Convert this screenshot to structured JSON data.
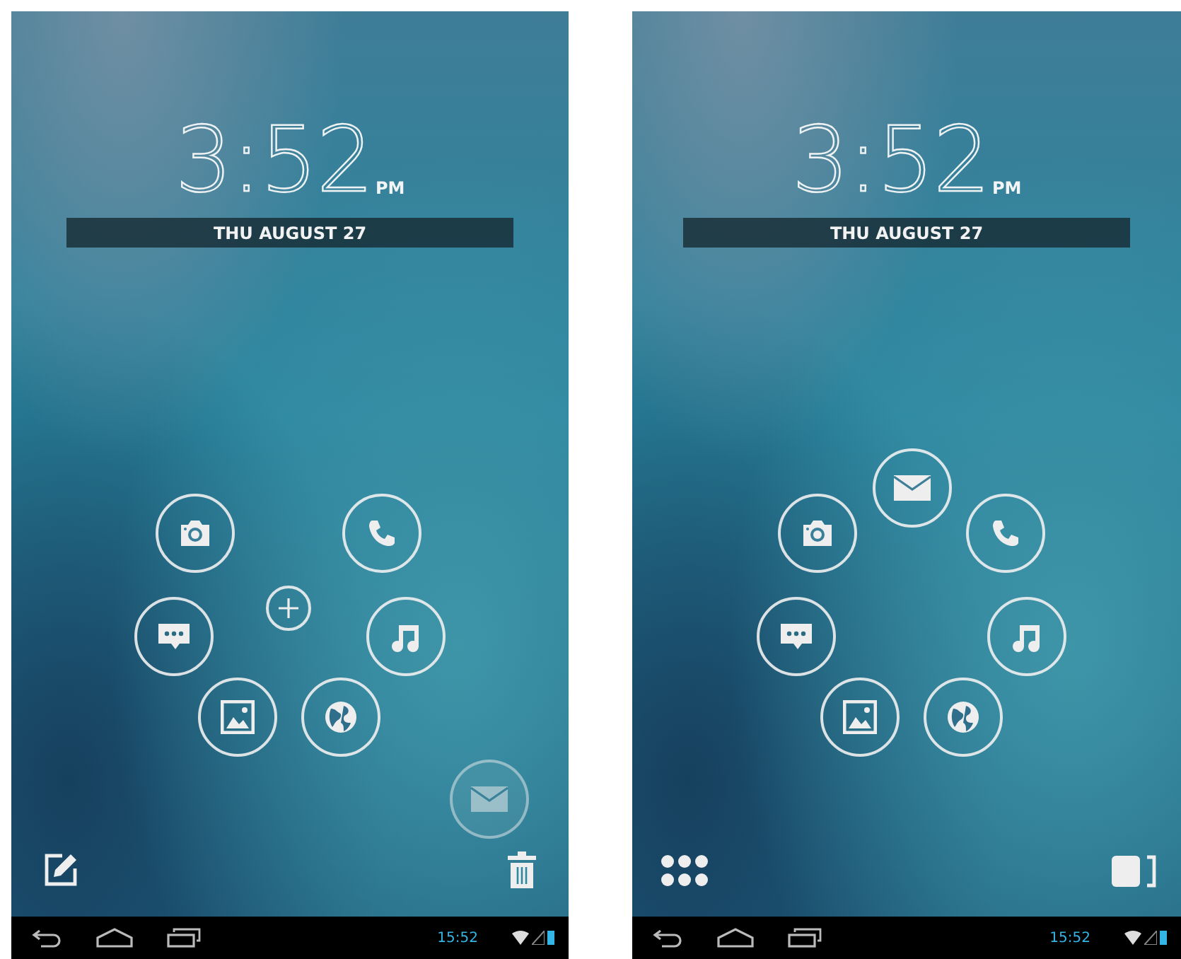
{
  "screens": [
    {
      "clock": {
        "time": "3:52",
        "ampm": "PM"
      },
      "date": "THU AUGUST 27",
      "editing": true,
      "apps": [
        {
          "kind": "camera",
          "dragging": false
        },
        {
          "kind": "phone",
          "dragging": false
        },
        {
          "kind": "message",
          "dragging": false
        },
        {
          "kind": "add",
          "dragging": false
        },
        {
          "kind": "music",
          "dragging": false
        },
        {
          "kind": "gallery",
          "dragging": false
        },
        {
          "kind": "globe",
          "dragging": false
        },
        {
          "kind": "mail",
          "dragging": true
        }
      ],
      "status_time": "15:52"
    },
    {
      "clock": {
        "time": "3:52",
        "ampm": "PM"
      },
      "date": "THU AUGUST 27",
      "editing": false,
      "apps": [
        {
          "kind": "mail",
          "dragging": false
        },
        {
          "kind": "camera",
          "dragging": false
        },
        {
          "kind": "phone",
          "dragging": false
        },
        {
          "kind": "message",
          "dragging": false
        },
        {
          "kind": "music",
          "dragging": false
        },
        {
          "kind": "gallery",
          "dragging": false
        },
        {
          "kind": "globe",
          "dragging": false
        }
      ],
      "status_time": "15:52"
    }
  ]
}
